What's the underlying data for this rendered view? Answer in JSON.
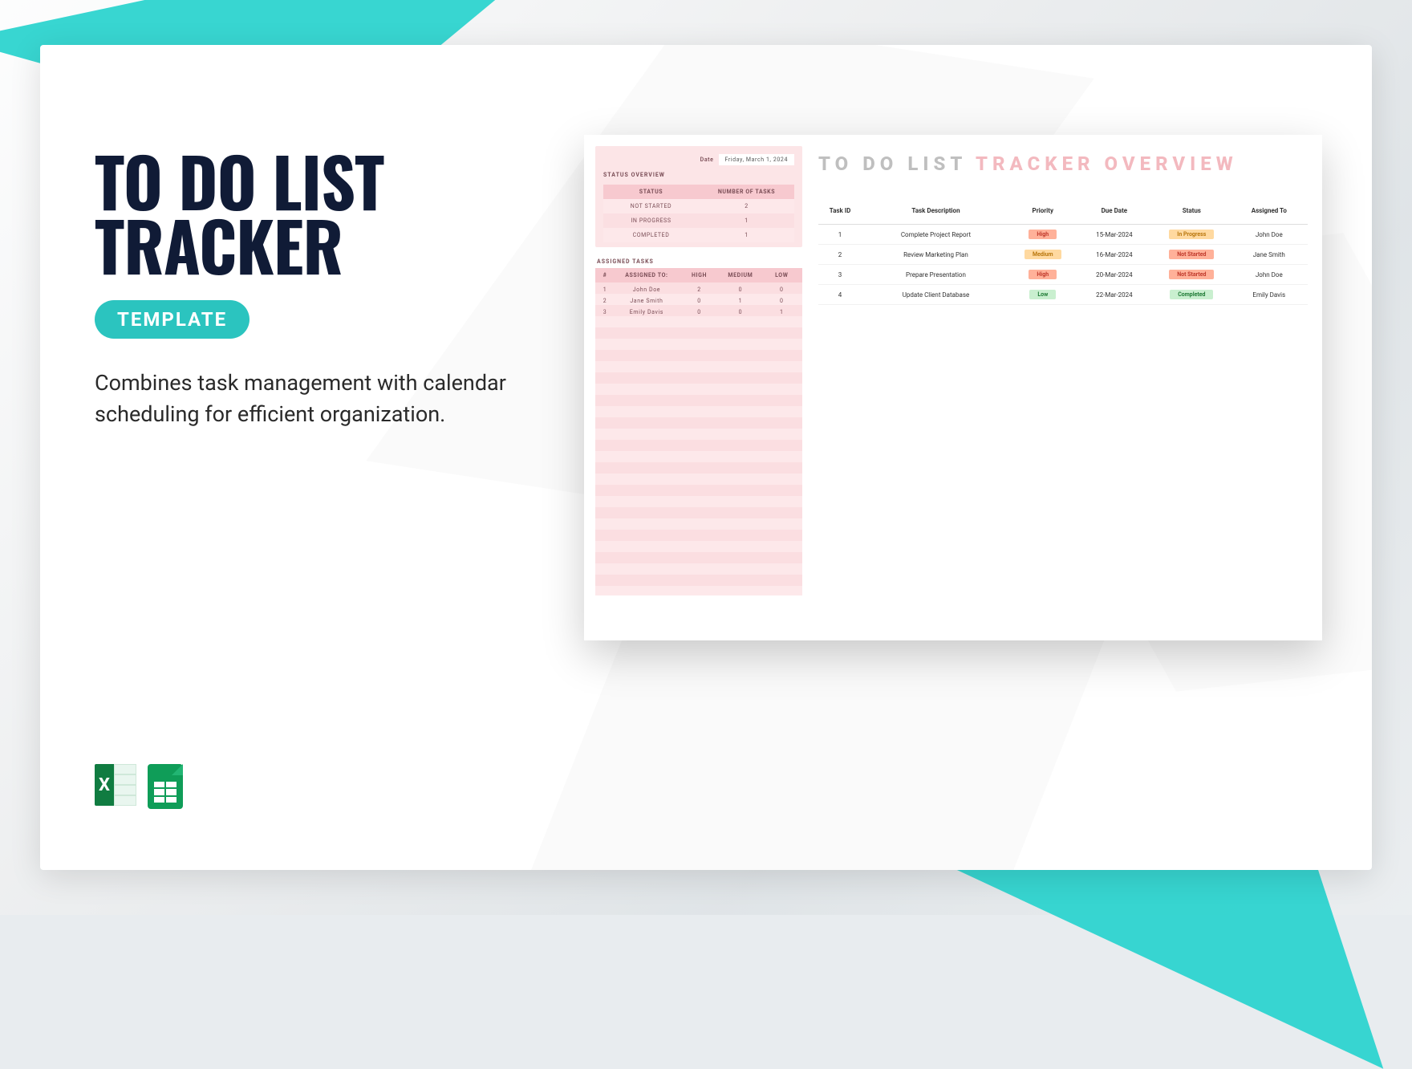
{
  "hero": {
    "title_line1": "TO DO LIST",
    "title_line2": "TRACKER",
    "badge": "TEMPLATE",
    "description": "Combines task management with calendar scheduling for efficient organization."
  },
  "icons": {
    "excel_letter": "X"
  },
  "preview": {
    "status_overview": {
      "heading": "STATUS OVERVIEW",
      "date_label": "Date",
      "date_value": "Friday, March 1, 2024",
      "status_col": "STATUS",
      "count_col": "NUMBER OF TASKS",
      "rows": [
        {
          "status": "NOT STARTED",
          "count": "2"
        },
        {
          "status": "IN PROGRESS",
          "count": "1"
        },
        {
          "status": "COMPLETED",
          "count": "1"
        }
      ]
    },
    "assigned": {
      "heading": "ASSIGNED TASKS",
      "cols": {
        "num": "#",
        "name": "ASSIGNED TO:",
        "high": "HIGH",
        "med": "MEDIUM",
        "low": "LOW"
      },
      "rows": [
        {
          "n": "1",
          "name": "John Doe",
          "high": "2",
          "med": "0",
          "low": "0"
        },
        {
          "n": "2",
          "name": "Jane Smith",
          "high": "0",
          "med": "1",
          "low": "0"
        },
        {
          "n": "3",
          "name": "Emily Davis",
          "high": "0",
          "med": "0",
          "low": "1"
        }
      ]
    },
    "main": {
      "title_a": "TO DO LIST ",
      "title_b": "TRACKER OVERVIEW",
      "cols": {
        "id": "Task ID",
        "desc": "Task Description",
        "pri": "Priority",
        "due": "Due Date",
        "stat": "Status",
        "asg": "Assigned To"
      },
      "rows": [
        {
          "id": "1",
          "desc": "Complete Project Report",
          "pri": "High",
          "pri_cls": "high",
          "due": "15-Mar-2024",
          "stat": "In Progress",
          "stat_cls": "inprog",
          "asg": "John Doe"
        },
        {
          "id": "2",
          "desc": "Review Marketing Plan",
          "pri": "Medium",
          "pri_cls": "med",
          "due": "16-Mar-2024",
          "stat": "Not Started",
          "stat_cls": "notst",
          "asg": "Jane Smith"
        },
        {
          "id": "3",
          "desc": "Prepare Presentation",
          "pri": "High",
          "pri_cls": "high",
          "due": "20-Mar-2024",
          "stat": "Not Started",
          "stat_cls": "notst",
          "asg": "John Doe"
        },
        {
          "id": "4",
          "desc": "Update Client Database",
          "pri": "Low",
          "pri_cls": "low",
          "due": "22-Mar-2024",
          "stat": "Completed",
          "stat_cls": "comp",
          "asg": "Emily Davis"
        }
      ]
    }
  }
}
